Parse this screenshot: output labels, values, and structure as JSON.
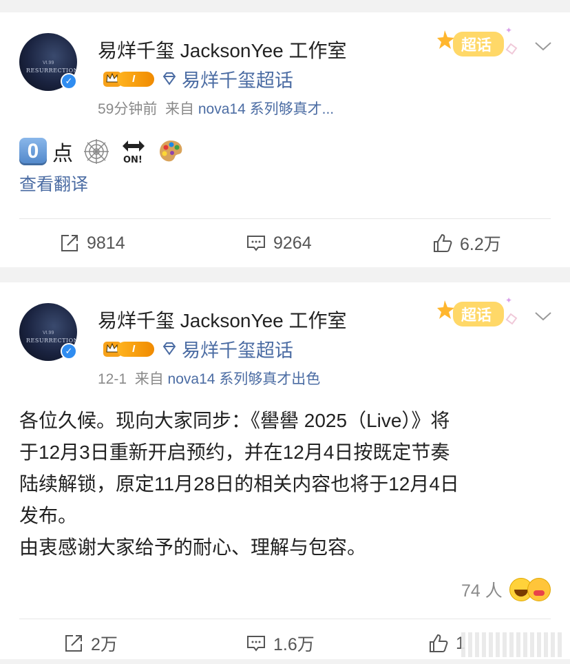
{
  "posts": [
    {
      "username": "易烊千玺 JacksonYee 工作室",
      "level_badge": "I",
      "super_topic": "易烊千玺超话",
      "time": "59分钟前",
      "source_prefix": "来自",
      "source": "nova14 系列够真才...",
      "content_text": "点",
      "emoji_key": "0",
      "emojis": [
        "spiderweb-icon",
        "on-arrow-icon",
        "palette-icon"
      ],
      "translate": "查看翻译",
      "actions": {
        "repost": "9814",
        "comment": "9264",
        "like": "6.2万"
      }
    },
    {
      "username": "易烊千玺 JacksonYee 工作室",
      "level_badge": "I",
      "super_topic": "易烊千玺超话",
      "time": "12-1",
      "source_prefix": "来自",
      "source": "nova14 系列够真才出色",
      "content_lines": [
        "各位久候。现向大家同步：《嚳嚳 2025（Live）》将",
        "于12月3日重新开启预约，并在12月4日按既定节奏",
        "陆续解锁，原定11月28日的相关内容也将于12月4日",
        "发布。",
        "由衷感谢大家给予的耐心、理解与包容。"
      ],
      "reaction_count": "74 人",
      "actions": {
        "repost": "2万",
        "comment": "1.6万",
        "like": "1"
      }
    }
  ],
  "super_topic_label": "超话",
  "colors": {
    "link": "#4b6ca3",
    "badge": "#f08a00",
    "verify": "#2f8cf0"
  }
}
